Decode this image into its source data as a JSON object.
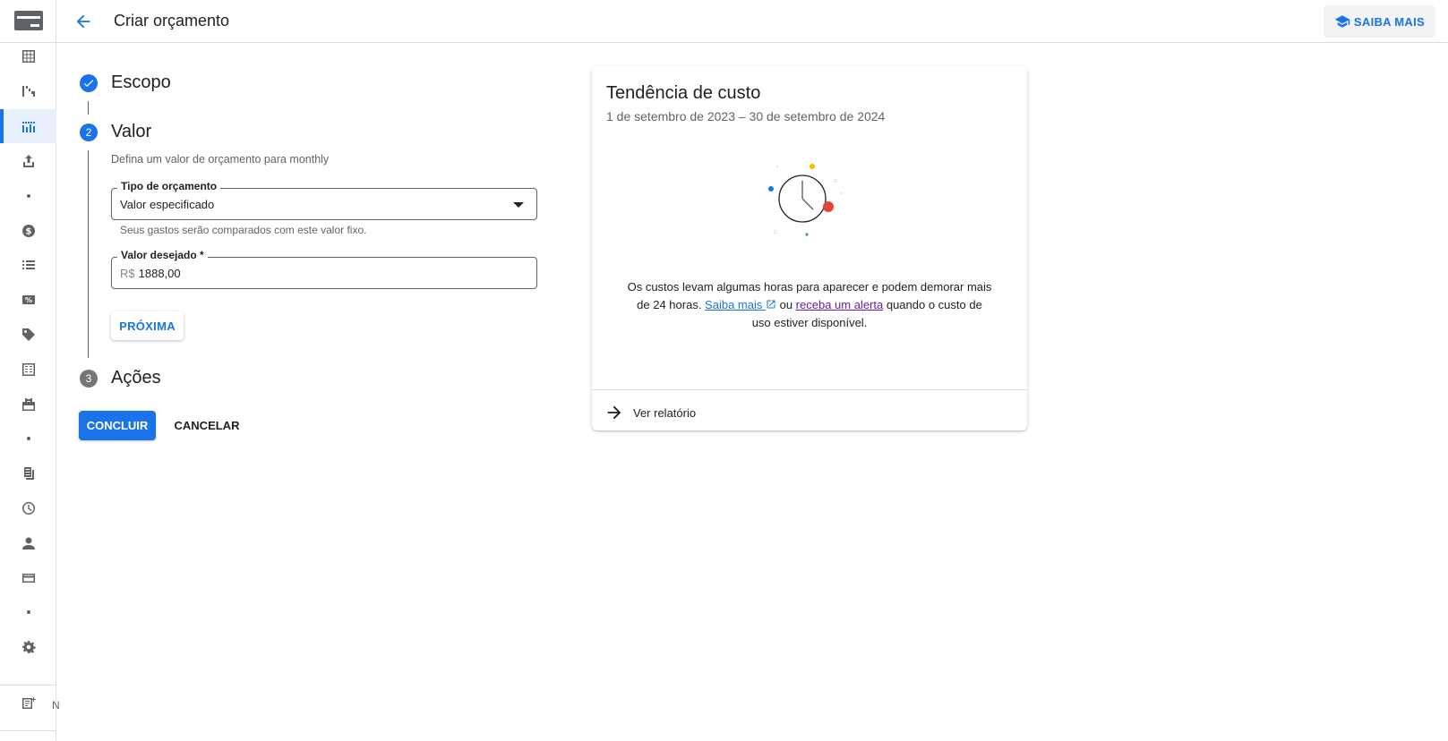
{
  "app": {
    "page_title": "Criar orçamento",
    "learn_more_label": "SAIBA MAIS",
    "rail_letter": "N"
  },
  "nav": {
    "items": [
      {
        "icon": "table-icon"
      },
      {
        "icon": "reports-icon"
      },
      {
        "icon": "budgets-icon",
        "active": true
      },
      {
        "icon": "export-icon"
      },
      {
        "icon": "dot"
      },
      {
        "icon": "billing-dollar-icon"
      },
      {
        "icon": "transactions-list-icon"
      },
      {
        "icon": "discounts-icon"
      },
      {
        "icon": "tag-icon"
      },
      {
        "icon": "calculator-icon"
      },
      {
        "icon": "commitments-icon"
      },
      {
        "icon": "dot"
      },
      {
        "icon": "documents-icon"
      },
      {
        "icon": "history-clock-icon"
      },
      {
        "icon": "account-person-icon"
      },
      {
        "icon": "payment-card-icon"
      },
      {
        "icon": "dot"
      },
      {
        "icon": "settings-gear-icon"
      },
      {
        "icon": "release-notes-icon"
      }
    ]
  },
  "stepper": {
    "step1": {
      "title": "Escopo",
      "state": "done"
    },
    "step2": {
      "number": "2",
      "title": "Valor",
      "description": "Defina um valor de orçamento para monthly"
    },
    "step3": {
      "number": "3",
      "title": "Ações"
    }
  },
  "form": {
    "budget_type": {
      "label": "Tipo de orçamento",
      "value": "Valor especificado",
      "hint": "Seus gastos serão comparados com este valor fixo."
    },
    "target_amount": {
      "label": "Valor desejado *",
      "prefix": "R$",
      "value": "1888,00"
    },
    "next_label": "PRÓXIMA",
    "finish_label": "CONCLUIR",
    "cancel_label": "CANCELAR"
  },
  "card": {
    "title": "Tendência de custo",
    "subtitle": "1 de setembro de 2023 – 30 de setembro de 2024",
    "msg_part1": "Os custos levam algumas horas para aparecer e podem demorar mais de 24 horas. ",
    "learn_more_link": "Saiba mais",
    "msg_part2": " ou ",
    "alert_link": "receba um alerta",
    "msg_part3": " quando o custo de uso estiver disponível.",
    "footer_label": "Ver relatório"
  },
  "colors": {
    "accent": "#1a73e8",
    "visited_link": "#681da8",
    "illustration_red": "#ea4335",
    "illustration_yellow": "#fbbc04",
    "illustration_green": "#34a853"
  }
}
